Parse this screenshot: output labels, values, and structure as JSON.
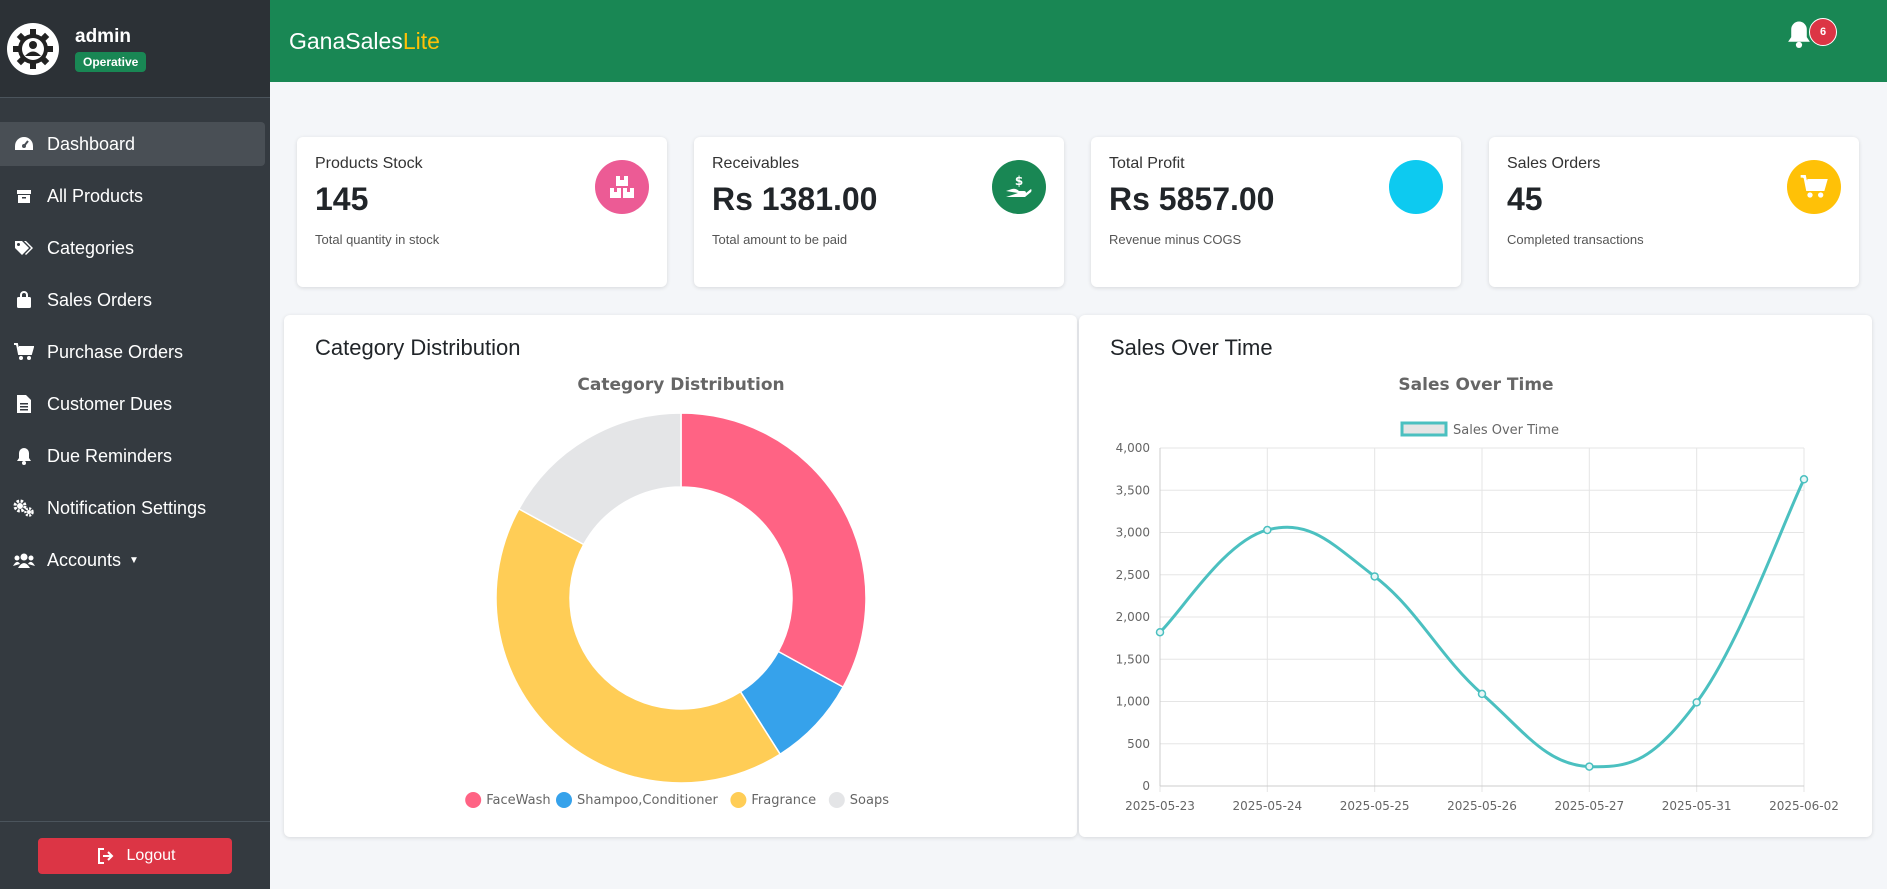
{
  "sidebar": {
    "user": {
      "name": "admin",
      "status": "Operative"
    },
    "items": [
      {
        "label": "Dashboard",
        "icon": "tachometer-icon",
        "active": true
      },
      {
        "label": "All Products",
        "icon": "box-icon"
      },
      {
        "label": "Categories",
        "icon": "tags-icon"
      },
      {
        "label": "Sales Orders",
        "icon": "shopping-bag-icon"
      },
      {
        "label": "Purchase Orders",
        "icon": "shopping-cart-icon"
      },
      {
        "label": "Customer Dues",
        "icon": "file-invoice-icon"
      },
      {
        "label": "Due Reminders",
        "icon": "bell-icon"
      },
      {
        "label": "Notification Settings",
        "icon": "cogs-icon"
      },
      {
        "label": "Accounts",
        "icon": "users-icon",
        "caret": true
      }
    ],
    "logout_label": "Logout"
  },
  "header": {
    "brand_main": "GanaSales",
    "brand_accent": "Lite",
    "notification_count": "6"
  },
  "stats": [
    {
      "title": "Products Stock",
      "value": "145",
      "subtitle": "Total quantity in stock",
      "icon": "boxes-icon",
      "color": "#ec5b95"
    },
    {
      "title": "Receivables",
      "value": "Rs 1381.00",
      "subtitle": "Total amount to be paid",
      "icon": "hand-dollar-icon",
      "color": "#198754"
    },
    {
      "title": "Total Profit",
      "value": "Rs 5857.00",
      "subtitle": "Revenue minus COGS",
      "icon": "chart-icon",
      "color": "#0dcaf0"
    },
    {
      "title": "Sales Orders",
      "value": "45",
      "subtitle": "Completed transactions",
      "icon": "shopping-cart-icon",
      "color": "#ffc107"
    }
  ],
  "category_card": {
    "title": "Category Distribution"
  },
  "sales_card": {
    "title": "Sales Over Time"
  },
  "chart_data": [
    {
      "type": "pie",
      "variant": "doughnut",
      "title": "Category Distribution",
      "categories": [
        "FaceWash",
        "Shampoo,Conditioner",
        "Fragrance",
        "Soaps"
      ],
      "values": [
        33,
        8,
        42,
        17
      ],
      "colors": [
        "#ff6384",
        "#36a2eb",
        "#ffcd56",
        "#e4e5e7"
      ],
      "legend": "bottom"
    },
    {
      "type": "line",
      "title": "Sales Over Time",
      "x": [
        "2025-05-23",
        "2025-05-24",
        "2025-05-25",
        "2025-05-26",
        "2025-05-27",
        "2025-05-31",
        "2025-06-02"
      ],
      "series": [
        {
          "name": "Sales Over Time",
          "values": [
            1820,
            3030,
            2480,
            1090,
            230,
            990,
            3630
          ],
          "color": "#4bc0c0"
        }
      ],
      "ylim": [
        0,
        4000
      ],
      "yticks": [
        "0",
        "500",
        "1,000",
        "1,500",
        "2,000",
        "2,500",
        "3,000",
        "3,500",
        "4,000"
      ],
      "grid": true,
      "legend": "top"
    }
  ]
}
